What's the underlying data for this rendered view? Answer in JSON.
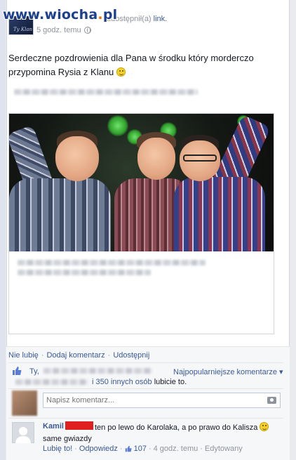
{
  "watermark": {
    "brand": "www.wiocha",
    "dot": ".",
    "tld": "pl"
  },
  "post": {
    "page_avatar_text": "Ty Klan",
    "shared_text": "udostępnił(a)",
    "shared_link": "link.",
    "time": "5 godz. temu",
    "text": "Serdeczne pozdrowienia dla Pana w środku który morderczo przypomina Rysia z Klanu"
  },
  "actions": {
    "like": "Nie lubię",
    "sep1": "·",
    "comment": "Dodaj komentarz",
    "sep2": "·",
    "share": "Udostępnij"
  },
  "likes": {
    "ty": "Ty,",
    "others_link": "i 350 innych osób",
    "suffix": "lubicie to.",
    "top_comments": "Najpopularniejsze komentarze ▾"
  },
  "composer": {
    "placeholder": "Napisz komentarz..."
  },
  "comment": {
    "author": "Kamil",
    "text": "ten po lewo do Karolaka, a po prawo do Kalisza",
    "text_tail": "same gwiazdy",
    "like_link": "Lubię to!",
    "reply_link": "Odpowiedz",
    "like_count": "107",
    "time": "4 godz. temu",
    "edited": "Edytowany",
    "sep": "·"
  },
  "colors": {
    "link": "#3b5998",
    "meta": "#90949c",
    "redaction": "#e0201e",
    "watermark_blue": "#1d3f8f",
    "watermark_orange": "#ff6a00"
  },
  "icons": [
    "globe-icon",
    "thumbs-up-icon",
    "camera-icon",
    "smiley-icon",
    "default-avatar-icon"
  ]
}
